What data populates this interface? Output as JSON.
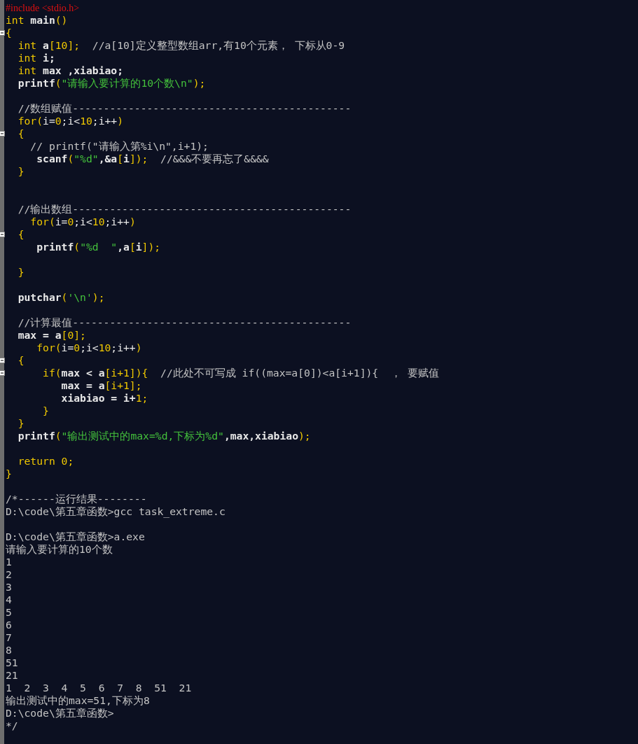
{
  "editor": {
    "lines": [
      {
        "fold": false,
        "segments": [
          {
            "kind": "pre",
            "text": "#include <stdio.h>"
          }
        ]
      },
      {
        "fold": false,
        "segments": [
          {
            "kind": "kw",
            "text": "int"
          },
          {
            "kind": "id",
            "text": " main"
          },
          {
            "kind": "kw",
            "text": "()"
          }
        ]
      },
      {
        "fold": true,
        "segments": [
          {
            "kind": "kw",
            "text": "{"
          }
        ]
      },
      {
        "fold": false,
        "segments": [
          {
            "kind": "kw",
            "text": "  int"
          },
          {
            "kind": "id",
            "text": " a"
          },
          {
            "kind": "kw",
            "text": "[10];"
          },
          {
            "kind": "cm",
            "text": "  //a[10]定义整型数组arr,有10个元素， 下标从0-9"
          }
        ]
      },
      {
        "fold": false,
        "segments": [
          {
            "kind": "kw",
            "text": "  int"
          },
          {
            "kind": "id",
            "text": " i;"
          }
        ]
      },
      {
        "fold": false,
        "segments": [
          {
            "kind": "kw",
            "text": "  int"
          },
          {
            "kind": "id",
            "text": " max ,xiabiao;"
          }
        ]
      },
      {
        "fold": false,
        "segments": [
          {
            "kind": "id",
            "text": "  printf"
          },
          {
            "kind": "kw",
            "text": "("
          },
          {
            "kind": "str",
            "text": "\"请输入要计算的10个数\\n\""
          },
          {
            "kind": "kw",
            "text": ");"
          }
        ]
      },
      {
        "fold": false
      },
      {
        "fold": false,
        "segments": [
          {
            "kind": "cm",
            "text": "  //数组赋值---------------------------------------------"
          }
        ]
      },
      {
        "fold": false,
        "segments": [
          {
            "kind": "kw",
            "text": "  for("
          },
          {
            "kind": "pl",
            "text": "i="
          },
          {
            "kind": "kw",
            "text": "0"
          },
          {
            "kind": "pl",
            "text": ";i<"
          },
          {
            "kind": "kw",
            "text": "10"
          },
          {
            "kind": "pl",
            "text": ";i++"
          },
          {
            "kind": "kw",
            "text": ")"
          }
        ]
      },
      {
        "fold": true,
        "segments": [
          {
            "kind": "kw",
            "text": "  {"
          }
        ]
      },
      {
        "fold": false,
        "segments": [
          {
            "kind": "cm",
            "text": "    // printf(\"请输入第%i\\n\",i+1);"
          }
        ]
      },
      {
        "fold": false,
        "segments": [
          {
            "kind": "id",
            "text": "     scanf"
          },
          {
            "kind": "kw",
            "text": "("
          },
          {
            "kind": "str",
            "text": "\"%d\""
          },
          {
            "kind": "id",
            "text": ",&a"
          },
          {
            "kind": "kw",
            "text": "["
          },
          {
            "kind": "id",
            "text": "i"
          },
          {
            "kind": "kw",
            "text": "]);"
          },
          {
            "kind": "cm",
            "text": "  //&&&不要再忘了&&&&"
          }
        ]
      },
      {
        "fold": false,
        "segments": [
          {
            "kind": "kw",
            "text": "  }"
          }
        ]
      },
      {
        "fold": false
      },
      {
        "fold": false
      },
      {
        "fold": false,
        "segments": [
          {
            "kind": "cm",
            "text": "  //输出数组---------------------------------------------"
          }
        ]
      },
      {
        "fold": false,
        "segments": [
          {
            "kind": "kw",
            "text": "    for("
          },
          {
            "kind": "pl",
            "text": "i="
          },
          {
            "kind": "kw",
            "text": "0"
          },
          {
            "kind": "pl",
            "text": ";i<"
          },
          {
            "kind": "kw",
            "text": "10"
          },
          {
            "kind": "pl",
            "text": ";i++"
          },
          {
            "kind": "kw",
            "text": ")"
          }
        ]
      },
      {
        "fold": true,
        "segments": [
          {
            "kind": "kw",
            "text": "  {"
          }
        ]
      },
      {
        "fold": false,
        "segments": [
          {
            "kind": "id",
            "text": "     printf"
          },
          {
            "kind": "kw",
            "text": "("
          },
          {
            "kind": "str",
            "text": "\"%d  \""
          },
          {
            "kind": "id",
            "text": ",a"
          },
          {
            "kind": "kw",
            "text": "["
          },
          {
            "kind": "id",
            "text": "i"
          },
          {
            "kind": "kw",
            "text": "]);"
          }
        ]
      },
      {
        "fold": false
      },
      {
        "fold": false,
        "segments": [
          {
            "kind": "kw",
            "text": "  }"
          }
        ]
      },
      {
        "fold": false
      },
      {
        "fold": false,
        "segments": [
          {
            "kind": "id",
            "text": "  putchar"
          },
          {
            "kind": "kw",
            "text": "("
          },
          {
            "kind": "str",
            "text": "'\\n'"
          },
          {
            "kind": "kw",
            "text": ");"
          }
        ]
      },
      {
        "fold": false
      },
      {
        "fold": false,
        "segments": [
          {
            "kind": "cm",
            "text": "  //计算最值---------------------------------------------"
          }
        ]
      },
      {
        "fold": false,
        "segments": [
          {
            "kind": "id",
            "text": "  max = a"
          },
          {
            "kind": "kw",
            "text": "[0];"
          }
        ]
      },
      {
        "fold": false,
        "segments": [
          {
            "kind": "kw",
            "text": "     for("
          },
          {
            "kind": "pl",
            "text": "i="
          },
          {
            "kind": "kw",
            "text": "0"
          },
          {
            "kind": "pl",
            "text": ";i<"
          },
          {
            "kind": "kw",
            "text": "10"
          },
          {
            "kind": "pl",
            "text": ";i++"
          },
          {
            "kind": "kw",
            "text": ")"
          }
        ]
      },
      {
        "fold": true,
        "segments": [
          {
            "kind": "kw",
            "text": "  {"
          }
        ]
      },
      {
        "fold": true,
        "segments": [
          {
            "kind": "kw",
            "text": "      if("
          },
          {
            "kind": "id",
            "text": "max < a"
          },
          {
            "kind": "kw",
            "text": "[i+1]){"
          },
          {
            "kind": "cm",
            "text": "  //此处不可写成 if((max=a[0])<a[i+1]){  ， 要赋值"
          }
        ]
      },
      {
        "fold": false,
        "segments": [
          {
            "kind": "id",
            "text": "         max = a"
          },
          {
            "kind": "kw",
            "text": "[i+1];"
          }
        ]
      },
      {
        "fold": false,
        "segments": [
          {
            "kind": "id",
            "text": "         xiabiao = i+"
          },
          {
            "kind": "kw",
            "text": "1;"
          }
        ]
      },
      {
        "fold": false,
        "segments": [
          {
            "kind": "kw",
            "text": "      }"
          }
        ]
      },
      {
        "fold": false,
        "segments": [
          {
            "kind": "kw",
            "text": "  }"
          }
        ]
      },
      {
        "fold": false,
        "segments": [
          {
            "kind": "id",
            "text": "  printf"
          },
          {
            "kind": "kw",
            "text": "("
          },
          {
            "kind": "str",
            "text": "\"输出测试中的max=%d,下标为%d\""
          },
          {
            "kind": "id",
            "text": ",max,xiabiao"
          },
          {
            "kind": "kw",
            "text": ");"
          }
        ]
      },
      {
        "fold": false
      },
      {
        "fold": false,
        "segments": [
          {
            "kind": "kw",
            "text": "  return 0;"
          }
        ]
      },
      {
        "fold": false,
        "segments": [
          {
            "kind": "kw",
            "text": "}"
          }
        ]
      },
      {
        "fold": false
      },
      {
        "fold": false,
        "segments": [
          {
            "kind": "cm",
            "text": "/*------运行结果--------"
          }
        ]
      },
      {
        "fold": false,
        "segments": [
          {
            "kind": "cm",
            "text": "D:\\code\\第五章函数>gcc task_extreme.c"
          }
        ]
      },
      {
        "fold": false
      },
      {
        "fold": false,
        "segments": [
          {
            "kind": "cm",
            "text": "D:\\code\\第五章函数>a.exe"
          }
        ]
      },
      {
        "fold": false,
        "segments": [
          {
            "kind": "cm",
            "text": "请输入要计算的10个数"
          }
        ]
      },
      {
        "fold": false,
        "segments": [
          {
            "kind": "cm",
            "text": "1"
          }
        ]
      },
      {
        "fold": false,
        "segments": [
          {
            "kind": "cm",
            "text": "2"
          }
        ]
      },
      {
        "fold": false,
        "segments": [
          {
            "kind": "cm",
            "text": "3"
          }
        ]
      },
      {
        "fold": false,
        "segments": [
          {
            "kind": "cm",
            "text": "4"
          }
        ]
      },
      {
        "fold": false,
        "segments": [
          {
            "kind": "cm",
            "text": "5"
          }
        ]
      },
      {
        "fold": false,
        "segments": [
          {
            "kind": "cm",
            "text": "6"
          }
        ]
      },
      {
        "fold": false,
        "segments": [
          {
            "kind": "cm",
            "text": "7"
          }
        ]
      },
      {
        "fold": false,
        "segments": [
          {
            "kind": "cm",
            "text": "8"
          }
        ]
      },
      {
        "fold": false,
        "segments": [
          {
            "kind": "cm",
            "text": "51"
          }
        ]
      },
      {
        "fold": false,
        "segments": [
          {
            "kind": "cm",
            "text": "21"
          }
        ]
      },
      {
        "fold": false,
        "segments": [
          {
            "kind": "cm",
            "text": "1  2  3  4  5  6  7  8  51  21"
          }
        ]
      },
      {
        "fold": false,
        "segments": [
          {
            "kind": "cm",
            "text": "输出测试中的max=51,下标为8"
          }
        ]
      },
      {
        "fold": false,
        "segments": [
          {
            "kind": "cm",
            "text": "D:\\code\\第五章函数>"
          }
        ]
      },
      {
        "fold": false,
        "segments": [
          {
            "kind": "cm",
            "text": "*/"
          }
        ]
      }
    ]
  }
}
